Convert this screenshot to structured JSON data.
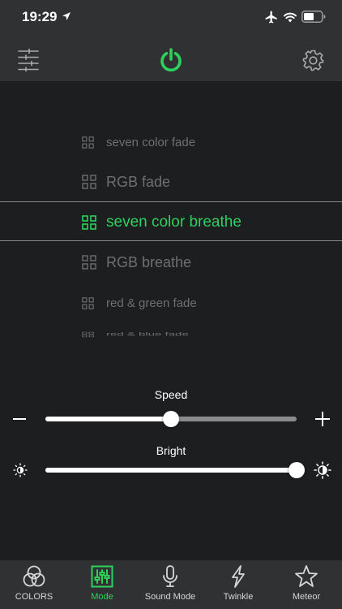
{
  "status_bar": {
    "time": "19:29"
  },
  "modes": [
    {
      "label": "seven color fade",
      "selected": false
    },
    {
      "label": "RGB fade",
      "selected": false
    },
    {
      "label": "seven color breathe",
      "selected": true
    },
    {
      "label": "RGB breathe",
      "selected": false
    },
    {
      "label": "red & green fade",
      "selected": false
    },
    {
      "label": "red & blue fade",
      "selected": false
    }
  ],
  "speed": {
    "label": "Speed",
    "value": 0.5
  },
  "bright": {
    "label": "Bright",
    "value": 1.0
  },
  "tabs": [
    {
      "label": "COLORS",
      "icon": "colors-icon",
      "active": false
    },
    {
      "label": "Mode",
      "icon": "mode-icon",
      "active": true
    },
    {
      "label": "Sound Mode",
      "icon": "microphone-icon",
      "active": false
    },
    {
      "label": "Twinkle",
      "icon": "lightning-icon",
      "active": false
    },
    {
      "label": "Meteor",
      "icon": "star-icon",
      "active": false
    }
  ],
  "colors": {
    "accent": "#2ed15e",
    "bar": "#303133",
    "background": "#1d1e20",
    "inactive_text": "#6e6f71"
  }
}
